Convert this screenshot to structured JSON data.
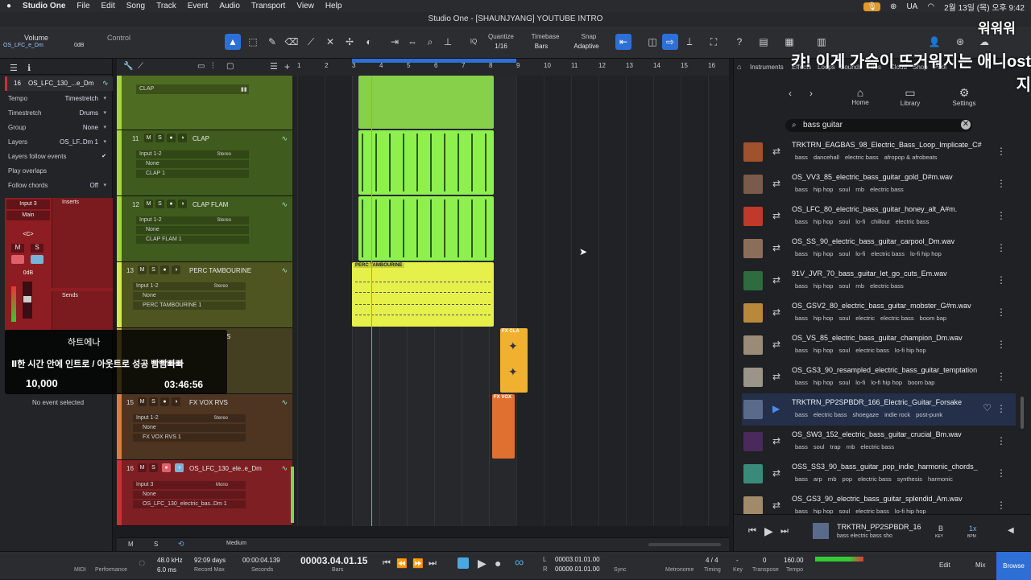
{
  "menubar": {
    "app": "Studio One",
    "items": [
      "File",
      "Edit",
      "Song",
      "Track",
      "Event",
      "Audio",
      "Transport",
      "View",
      "Help"
    ],
    "status": [
      "UA",
      "2월 13일 (목) 오후 9:42"
    ]
  },
  "window_title": "Studio One - [SHAUNJYANG] YOUTUBE INTRO",
  "toolbar": {
    "volume_label": "Volume",
    "volume_track": "OS_LFC_e_Dm",
    "volume_db": "0dB",
    "control_label": "Control",
    "quantize_label": "Quantize",
    "quantize_value": "1/16",
    "timebase_label": "Timebase",
    "timebase_value": "Bars",
    "snap_label": "Snap",
    "snap_value": "Adaptive",
    "overlay_title": "워워워"
  },
  "inspector": {
    "track_num": "16",
    "track_name": "OS_LFC_130_...e_Dm",
    "rows": [
      {
        "label": "Tempo",
        "value": "Timestretch"
      },
      {
        "label": "Timestretch",
        "value": "Drums"
      },
      {
        "label": "Group",
        "value": "None"
      },
      {
        "label": "Layers",
        "value": "OS_LF..Dm 1"
      },
      {
        "label": "Layers follow events",
        "value": ""
      },
      {
        "label": "Play overlaps",
        "value": ""
      },
      {
        "label": "Follow chords",
        "value": "Off"
      }
    ],
    "channel": {
      "input": "Input 3",
      "main": "Main",
      "pan": "<C>",
      "mute": "M",
      "solo": "S",
      "db": "0dB",
      "inserts": "Inserts",
      "sends": "Sends"
    },
    "no_event": "No event selected"
  },
  "tracks": [
    {
      "num": "",
      "name": "CLAP",
      "color": "#5d7f2a",
      "strip": "#a6d63f"
    },
    {
      "num": "11",
      "name": "CLAP",
      "color": "#4d6a24",
      "strip": "#a6d63f",
      "input": "Input 1-2",
      "stereo": "Stereo",
      "none": "None",
      "layer": "CLAP 1"
    },
    {
      "num": "12",
      "name": "CLAP FLAM",
      "color": "#4d6a24",
      "strip": "#a6d63f",
      "input": "Input 1-2",
      "stereo": "Stereo",
      "none": "None",
      "layer": "CLAP FLAM 1"
    },
    {
      "num": "13",
      "name": "PERC TAMBOURINE",
      "color": "#5e6628",
      "strip": "#d9e84a",
      "input": "Input 1-2",
      "stereo": "Stereo",
      "none": "None",
      "layer": "PERC TAMBOURINE 1"
    },
    {
      "num": "",
      "name": "S",
      "color": "#4d4a28",
      "strip": "#e0b84a"
    },
    {
      "num": "15",
      "name": "FX VOX RVS",
      "color": "#5b3f28",
      "strip": "#e07a3a",
      "input": "Input 1-2",
      "stereo": "Stereo",
      "none": "None",
      "layer": "FX VOX RVS 1"
    },
    {
      "num": "16",
      "name": "OS_LFC_130_ele..e_Dm",
      "color": "#8a2326",
      "strip": "#c93037",
      "input": "Input 3",
      "stereo": "Mono",
      "none": "None",
      "layer": "OS_LFC_130_electric_bas..Dm 1"
    }
  ],
  "ruler": [
    "1",
    "2",
    "3",
    "4",
    "5",
    "6",
    "7",
    "8",
    "9",
    "10",
    "11",
    "12",
    "13",
    "14",
    "15",
    "16"
  ],
  "clips": {
    "perc": "PERC TAMBOURINE",
    "fx1": "FX CLA",
    "fx2": "FX VOX"
  },
  "browser": {
    "tabs": [
      "Instruments",
      "Effects",
      "Loops",
      "Sounds",
      "Files",
      "Cloud",
      "Shop",
      "Pool"
    ],
    "nav": [
      "Home",
      "Library",
      "Settings"
    ],
    "search": "bass guitar",
    "items": [
      {
        "name": "TRKTRN_EAGBAS_98_Electric_Bass_Loop_Implicate_C#",
        "tags": [
          "bass",
          "dancehall",
          "electric bass",
          "afropop & afrobeats"
        ],
        "thumb": "#a0522d"
      },
      {
        "name": "OS_VV3_85_electric_bass_guitar_gold_D#m.wav",
        "tags": [
          "bass",
          "hip hop",
          "soul",
          "rnb",
          "electric bass"
        ],
        "thumb": "#7a5a4a"
      },
      {
        "name": "OS_LFC_80_electric_bass_guitar_honey_alt_A#m.",
        "tags": [
          "bass",
          "hip hop",
          "soul",
          "lo-fi",
          "chillout",
          "electric bass"
        ],
        "thumb": "#c0392b"
      },
      {
        "name": "OS_SS_90_electric_bass_guitar_carpool_Dm.wav",
        "tags": [
          "bass",
          "hip hop",
          "soul",
          "lo-fi",
          "electric bass",
          "lo-fi hip hop"
        ],
        "thumb": "#8b6e5a"
      },
      {
        "name": "91V_JVR_70_bass_guitar_let_go_cuts_Em.wav",
        "tags": [
          "bass",
          "hip hop",
          "soul",
          "rnb",
          "electric bass"
        ],
        "thumb": "#2e6b3e"
      },
      {
        "name": "OS_GSV2_80_electric_bass_guitar_mobster_G#m.wav",
        "tags": [
          "bass",
          "hip hop",
          "soul",
          "electric",
          "electric bass",
          "boom bap"
        ],
        "thumb": "#b8893a"
      },
      {
        "name": "OS_VS_85_electric_bass_guitar_champion_Dm.wav",
        "tags": [
          "bass",
          "hip hop",
          "soul",
          "electric bass",
          "lo-fi hip hop"
        ],
        "thumb": "#9a8a78"
      },
      {
        "name": "OS_GS3_90_resampled_electric_bass_guitar_temptation",
        "tags": [
          "bass",
          "hip hop",
          "soul",
          "lo-fi",
          "lo-fi hip hop",
          "boom bap"
        ],
        "thumb": "#9b9488"
      },
      {
        "name": "TRKTRN_PP2SPBDR_166_Electric_Guitar_Forsake",
        "tags": [
          "bass",
          "electric bass",
          "shoegaze",
          "indie rock",
          "post-punk"
        ],
        "thumb": "#5a6a8a"
      },
      {
        "name": "OS_SW3_152_electric_bass_guitar_crucial_Bm.wav",
        "tags": [
          "bass",
          "soul",
          "trap",
          "rnb",
          "electric bass"
        ],
        "thumb": "#4a2a5a"
      },
      {
        "name": "OSS_SS3_90_bass_guitar_pop_indie_harmonic_chords_",
        "tags": [
          "bass",
          "arp",
          "rnb",
          "pop",
          "electric bass",
          "synthesis",
          "harmonic"
        ],
        "thumb": "#3a8a7a"
      },
      {
        "name": "OS_GS3_90_electric_bass_guitar_splendid_Am.wav",
        "tags": [
          "bass",
          "hip hop",
          "soul",
          "electric bass",
          "lo-fi hip hop"
        ],
        "thumb": "#a08a6a"
      }
    ],
    "player": {
      "name": "TRKTRN_PP2SPBDR_16",
      "tags": "bass  electric bass  sho",
      "key": "B",
      "key_lbl": "KEY",
      "speed": "1x",
      "speed_lbl": "BPM"
    }
  },
  "transport": {
    "midi": "MIDI",
    "performance": "Performance",
    "sample_rate": "48.0 kHz",
    "latency": "6.0 ms",
    "record_days": "92:09 days",
    "record_max": "Record Max",
    "seconds": "00:00:04.139",
    "seconds_lbl": "Seconds",
    "bars": "00003.04.01.15",
    "bars_lbl": "Bars",
    "loop_l": "00003.01.01.00",
    "loop_r": "00009.01.01.00",
    "l": "L",
    "r": "R",
    "sync": "Sync",
    "metronome": "Metronome",
    "timing": "4 / 4",
    "timing_lbl": "Timing",
    "key": "-",
    "key_lbl": "Key",
    "transpose": "0",
    "transpose_lbl": "Transpose",
    "tempo": "160.00",
    "tempo_lbl": "Tempo",
    "edit": "Edit",
    "mix": "Mix",
    "browse": "Browse"
  },
  "tracks_footer": {
    "m": "M",
    "s": "S",
    "zoom": "Medium"
  },
  "overlay": {
    "line1": "캬! 이게 가슴이 뜨거워지는 애니ost",
    "line2": "지",
    "donate_name": "하트에나",
    "donate_msg": "Ⅱ한 시간 안에 인트로 / 아웃트로 성공 빰빰빠빠",
    "donate_amount": "10,000",
    "donate_time": "03:46:56"
  },
  "colors": {
    "accent": "#2e6fd6",
    "green_clip": "#86e04a",
    "yellow_clip": "#e6f04a",
    "orange_clip": "#f0b030",
    "vox_clip": "#e07030",
    "red_track": "#8e1d23"
  }
}
